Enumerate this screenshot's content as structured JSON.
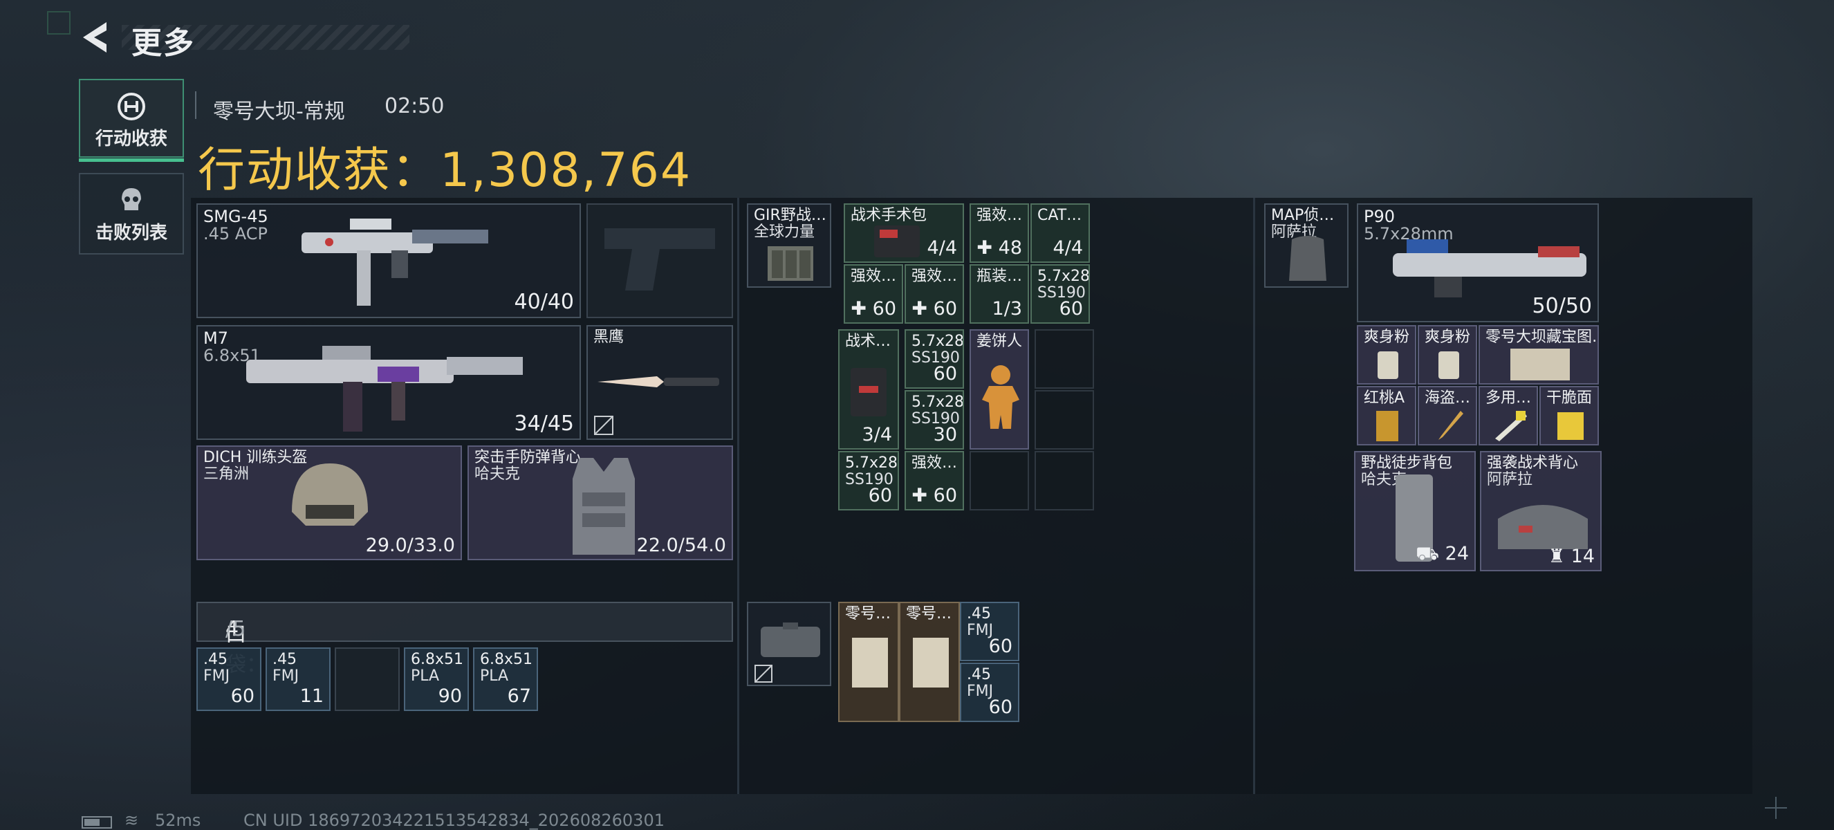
{
  "header": {
    "title": "更多"
  },
  "tabs": [
    {
      "label": "行动收获",
      "active": true
    },
    {
      "label": "击败列表",
      "active": false
    }
  ],
  "match": {
    "map": "零号大坝-常规",
    "time": "02:50"
  },
  "harvest": {
    "label": "行动收获：",
    "value": "1,308,764",
    "color": "#f5c84c"
  },
  "equipment": {
    "primary": {
      "name": "SMG-45",
      "caliber": ".45 ACP",
      "ammo": "40/40"
    },
    "secondary": {
      "name": "M7",
      "caliber": "6.8x51",
      "ammo": "34/45"
    },
    "melee": {
      "name": "黑鹰"
    },
    "helmet": {
      "name": "DICH 训练头盔",
      "brand": "三角洲",
      "durability": "29.0/33.0"
    },
    "armor": {
      "name": "突击手防弹背心",
      "brand": "哈夫克",
      "durability": "22.0/54.0"
    }
  },
  "pocket": {
    "label": "口袋：",
    "count": "4",
    "capacity": "/5",
    "items": [
      {
        "name": ".45",
        "sub": "FMJ",
        "qty": "60"
      },
      {
        "name": ".45",
        "sub": "FMJ",
        "qty": "11"
      },
      {
        "name": "6.8x51",
        "sub": "PLA",
        "qty": "90"
      },
      {
        "name": "6.8x51",
        "sub": "PLA",
        "qty": "67"
      }
    ]
  },
  "rig": {
    "name": "GIR野战…",
    "sub": "全球力量",
    "items": {
      "surgery_kit": {
        "name": "战术手术包",
        "qty": "4/4"
      },
      "stim1": {
        "name": "强效…",
        "qty": "48"
      },
      "cat": {
        "name": "CAT…",
        "qty": "4/4"
      },
      "stim2": {
        "name": "强效…",
        "qty": "60"
      },
      "stim3": {
        "name": "强效…",
        "qty": "60"
      },
      "bottle": {
        "name": "瓶装…",
        "qty": "1/3"
      },
      "ammo57a": {
        "name": "5.7x28",
        "sub": "SS190",
        "qty": "60"
      },
      "tactical": {
        "name": "战术…",
        "qty": "3/4"
      },
      "ammo57b": {
        "name": "5.7x28",
        "sub": "SS190",
        "qty": "60"
      },
      "ammo57c": {
        "name": "5.7x28",
        "sub": "SS190",
        "qty": "30"
      },
      "ginger": {
        "name": "姜饼人"
      },
      "ammo57d": {
        "name": "5.7x28",
        "sub": "SS190",
        "qty": "60"
      },
      "stim4": {
        "name": "强效…",
        "qty": "60"
      }
    }
  },
  "case": {
    "items": [
      {
        "name": "零号…"
      },
      {
        "name": "零号…"
      },
      {
        "name": ".45",
        "sub": "FMJ",
        "qty": "60"
      },
      {
        "name": ".45",
        "sub": "FMJ",
        "qty": "60"
      }
    ]
  },
  "backpack_slot": {
    "name": "MAP侦…",
    "sub": "阿萨拉"
  },
  "backpack": {
    "gun": {
      "name": "P90",
      "caliber": "5.7x28mm",
      "ammo": "50/50"
    },
    "items": [
      {
        "name": "爽身粉"
      },
      {
        "name": "爽身粉"
      },
      {
        "name": "零号大坝藏宝图…"
      },
      {
        "name": "红桃A"
      },
      {
        "name": "海盗…"
      },
      {
        "name": "多用…"
      },
      {
        "name": "干脆面"
      }
    ],
    "bag1": {
      "name": "野战徒步背包",
      "sub": "哈夫克",
      "qty": "24"
    },
    "bag2": {
      "name": "强袭战术背心",
      "sub": "阿萨拉",
      "qty": "14"
    }
  },
  "status": {
    "ping": "52ms",
    "uid": "CN UID 186972034221513542834_202608260301"
  }
}
